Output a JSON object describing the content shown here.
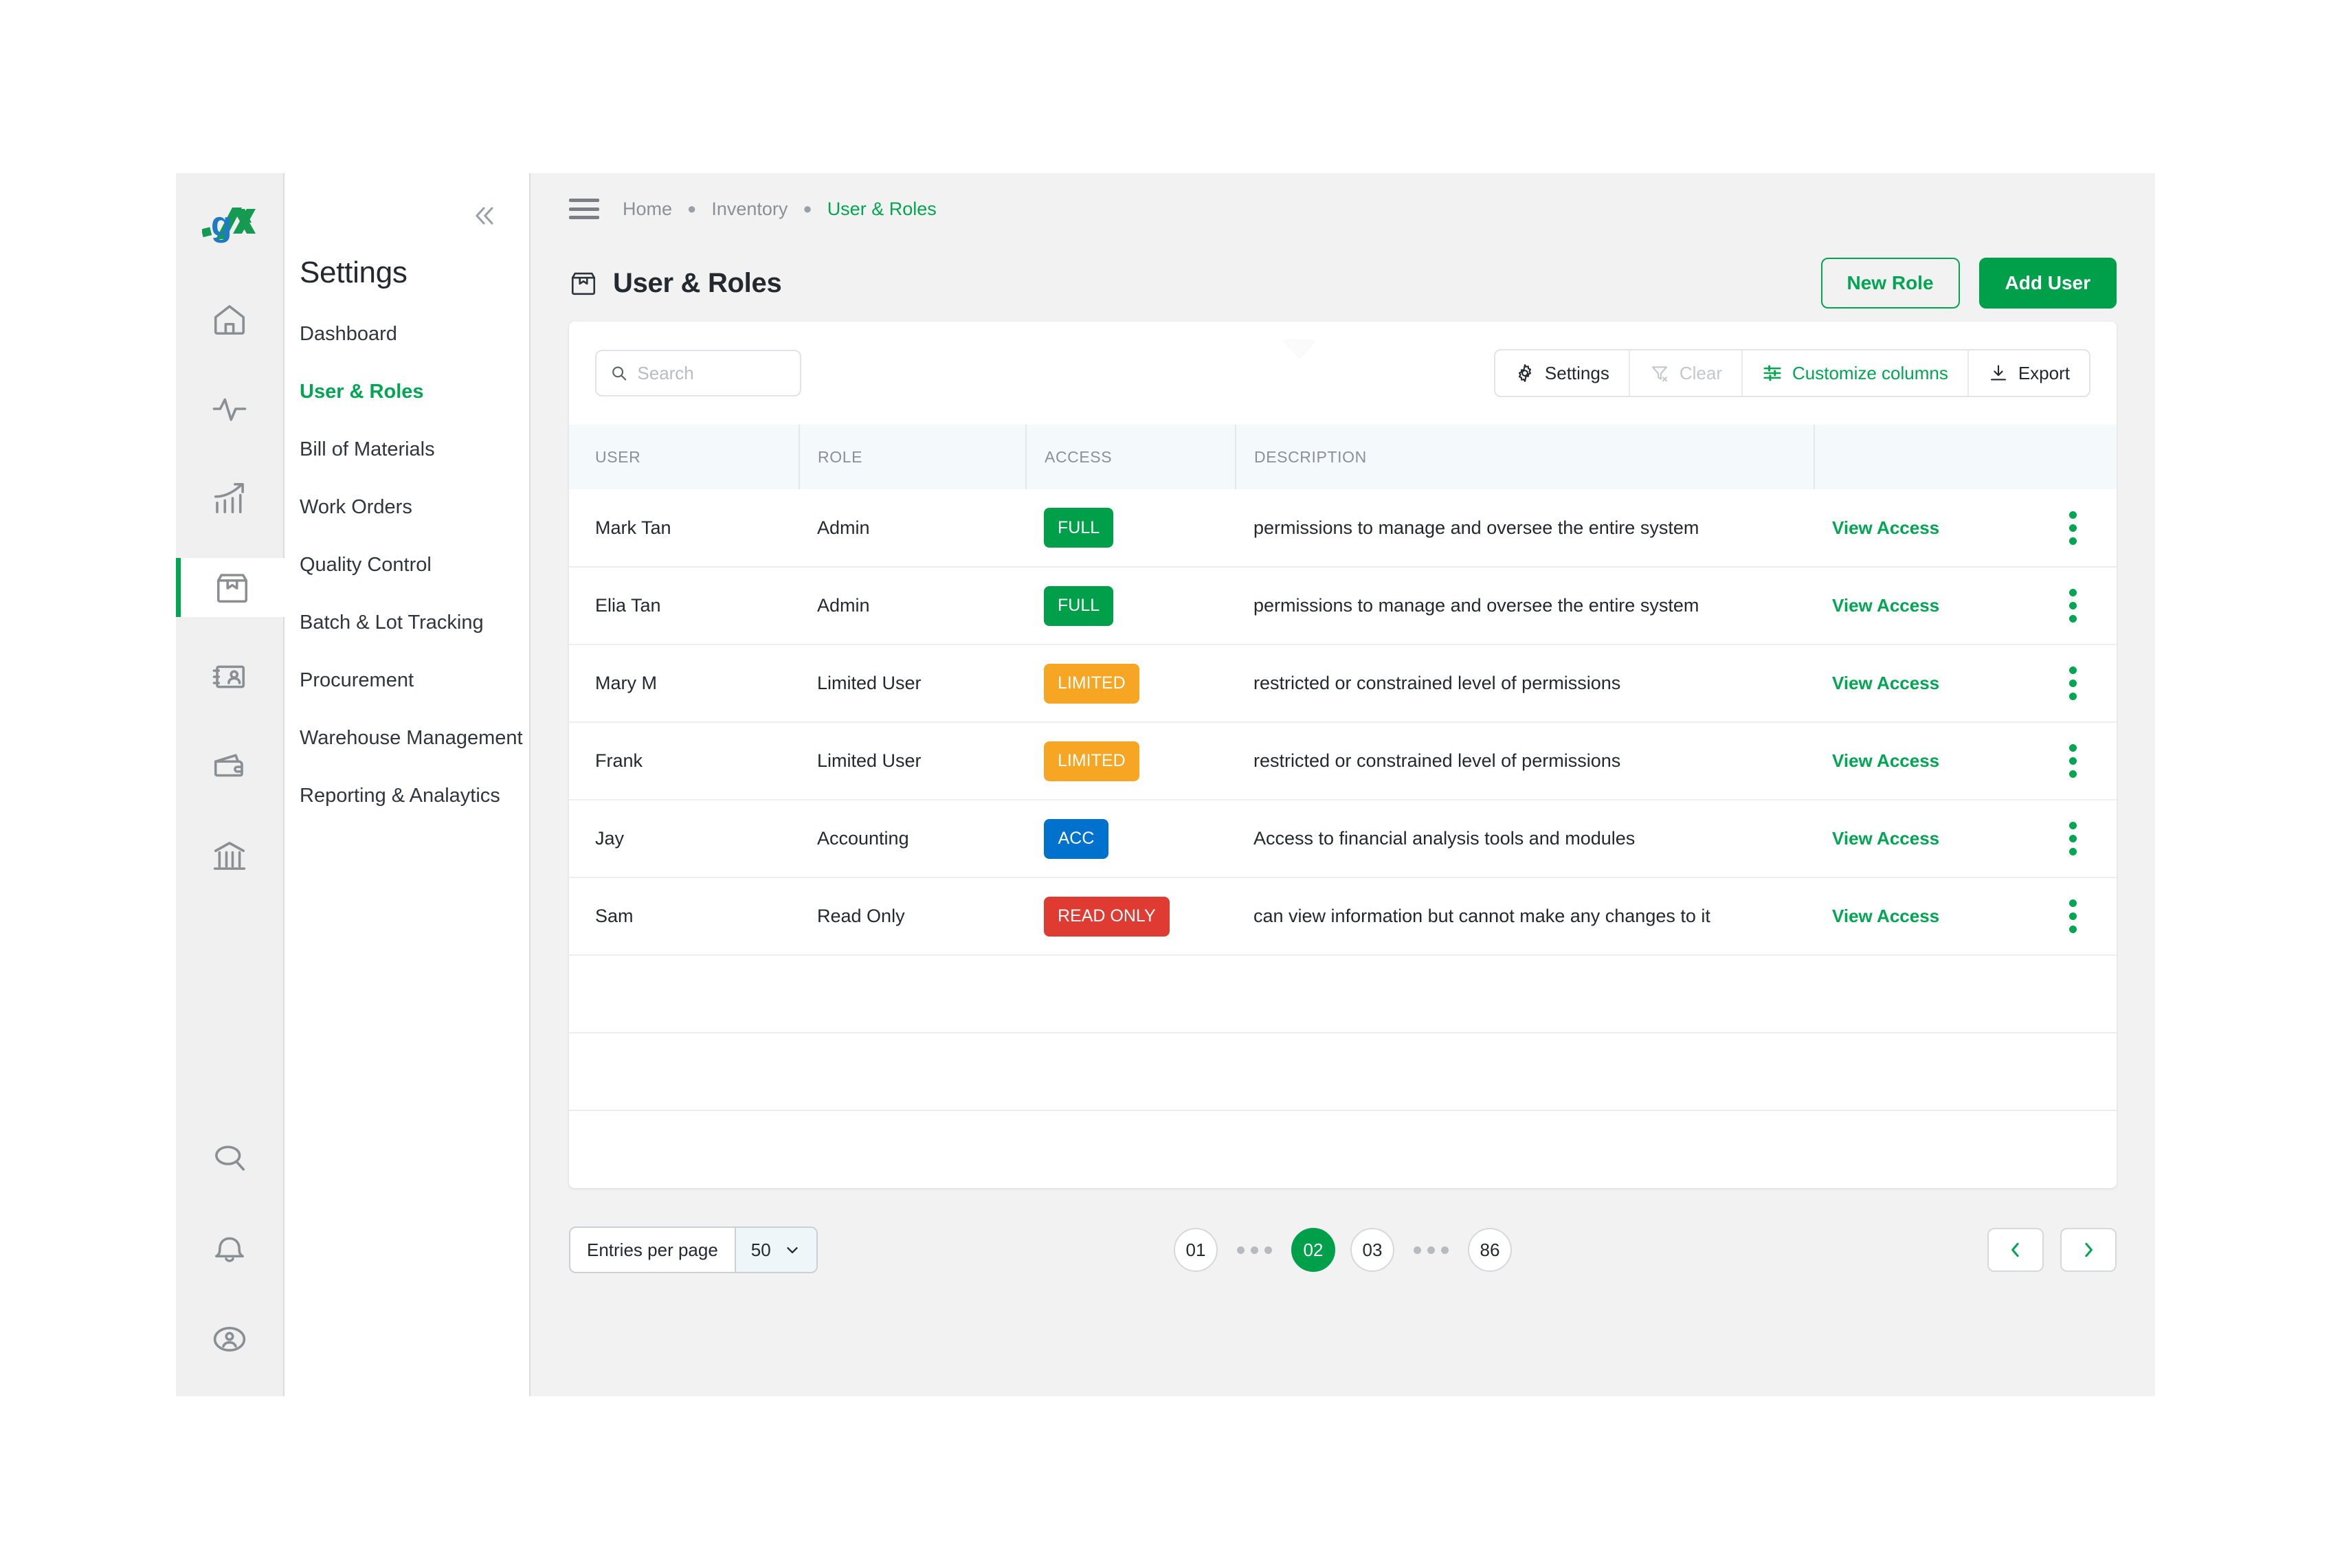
{
  "brand": {
    "logo_text": ".gx"
  },
  "rail": {
    "items": [
      {
        "icon": "home-icon",
        "name": "home"
      },
      {
        "icon": "activity-pulse-icon",
        "name": "activity"
      },
      {
        "icon": "trending-chart-icon",
        "name": "analytics"
      },
      {
        "icon": "package-box-icon",
        "name": "inventory",
        "active": true
      },
      {
        "icon": "contact-card-icon",
        "name": "contacts"
      },
      {
        "icon": "wallet-icon",
        "name": "wallet"
      },
      {
        "icon": "bank-icon",
        "name": "finance"
      }
    ],
    "bottom_items": [
      {
        "icon": "search-icon",
        "name": "search"
      },
      {
        "icon": "bell-icon",
        "name": "notifications"
      },
      {
        "icon": "user-circle-icon",
        "name": "account"
      }
    ]
  },
  "submenu": {
    "title": "Settings",
    "collapse_icon": "chevron-double-left-icon",
    "items": [
      {
        "label": "Dashboard",
        "active": false
      },
      {
        "label": "User & Roles",
        "active": true
      },
      {
        "label": "Bill of Materials",
        "active": false
      },
      {
        "label": "Work Orders",
        "active": false
      },
      {
        "label": "Quality Control",
        "active": false
      },
      {
        "label": "Batch & Lot Tracking",
        "active": false
      },
      {
        "label": "Procurement",
        "active": false
      },
      {
        "label": "Warehouse Management",
        "active": false
      },
      {
        "label": "Reporting & Analaytics",
        "active": false
      }
    ]
  },
  "topbar": {
    "menu_icon": "hamburger-menu-icon",
    "breadcrumb": [
      {
        "label": "Home",
        "current": false
      },
      {
        "label": "Inventory",
        "current": false
      },
      {
        "label": "User & Roles",
        "current": true
      }
    ]
  },
  "header": {
    "icon": "package-box-icon",
    "title": "User & Roles",
    "new_role_label": "New Role",
    "add_user_label": "Add User"
  },
  "toolbar": {
    "search_placeholder": "Search",
    "search_value": "",
    "search_icon": "search-icon",
    "buttons": [
      {
        "label": "Settings",
        "icon": "gear-icon",
        "state": "normal"
      },
      {
        "label": "Clear",
        "icon": "filter-clear-icon",
        "state": "disabled"
      },
      {
        "label": "Customize columns",
        "icon": "sliders-icon",
        "state": "accent"
      },
      {
        "label": "Export",
        "icon": "download-icon",
        "state": "normal"
      }
    ]
  },
  "table": {
    "columns": [
      "USER",
      "ROLE",
      "ACCESS",
      "DESCRIPTION",
      "",
      ""
    ],
    "rows": [
      {
        "user": "Mark Tan",
        "role": "Admin",
        "access": "FULL",
        "access_color": "#00a04b",
        "description": "permissions to manage and oversee the entire system",
        "link": "View Access"
      },
      {
        "user": "Elia Tan",
        "role": "Admin",
        "access": "FULL",
        "access_color": "#00a04b",
        "description": "permissions to manage and oversee the entire system",
        "link": "View Access"
      },
      {
        "user": "Mary M",
        "role": "Limited User",
        "access": "LIMITED",
        "access_color": "#f6a623",
        "description": "restricted or constrained level of permissions",
        "link": "View Access"
      },
      {
        "user": "Frank",
        "role": "Limited User",
        "access": "LIMITED",
        "access_color": "#f6a623",
        "description": "restricted or constrained level of permissions",
        "link": "View Access"
      },
      {
        "user": "Jay",
        "role": "Accounting",
        "access": "ACC",
        "access_color": "#0072ce",
        "description": "Access to financial analysis tools and modules",
        "link": "View Access"
      },
      {
        "user": "Sam",
        "role": "Read Only",
        "access": "READ ONLY",
        "access_color": "#e03b32",
        "description": "can view information but cannot make any changes to it",
        "link": "View Access"
      }
    ],
    "empty_rows": 3,
    "row_menu_icon": "kebab-menu-icon"
  },
  "footer": {
    "entries_label": "Entries per page",
    "entries_value": "50",
    "entries_chevron": "chevron-down-icon",
    "pages": [
      {
        "label": "01",
        "type": "page",
        "active": false
      },
      {
        "label": "",
        "type": "ellipsis",
        "active": false
      },
      {
        "label": "02",
        "type": "page",
        "active": true
      },
      {
        "label": "03",
        "type": "page",
        "active": false
      },
      {
        "label": "",
        "type": "ellipsis",
        "active": false
      },
      {
        "label": "86",
        "type": "page",
        "active": false
      }
    ],
    "prev_icon": "chevron-left-icon",
    "next_icon": "chevron-right-icon"
  },
  "colors": {
    "accent_green": "#00a651",
    "primary_green": "#00a04b",
    "logo_blue": "#1f7ac6",
    "logo_green": "#159a52"
  }
}
